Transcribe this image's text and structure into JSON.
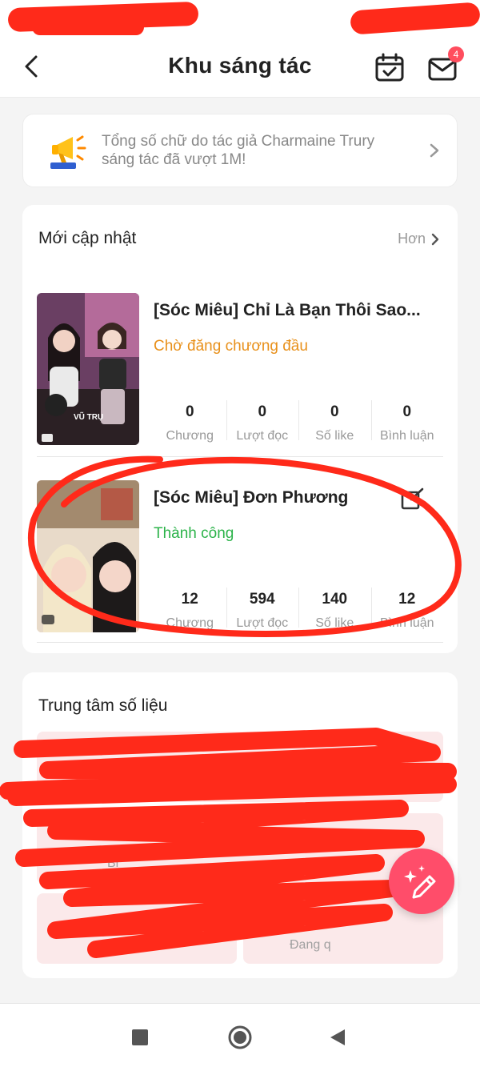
{
  "header": {
    "title": "Khu sáng tác",
    "mail_badge": "4"
  },
  "notice": {
    "text": "Tổng số chữ do tác giả Charmaine Trury sáng tác đã vượt 1M!"
  },
  "recent": {
    "heading": "Mới cập nhật",
    "more_label": "Hơn",
    "books": [
      {
        "title": "[Sóc Miêu] Chỉ Là Bạn Thôi Sao...",
        "status": "Chờ đăng chương đầu",
        "status_color": "#e8901a",
        "cover_caption": "VŨ TRỤ",
        "stats": [
          {
            "value": "0",
            "label": "Chương"
          },
          {
            "value": "0",
            "label": "Lượt đọc"
          },
          {
            "value": "0",
            "label": "Số like"
          },
          {
            "value": "0",
            "label": "Bình luận"
          }
        ]
      },
      {
        "title": "[Sóc Miêu] Đơn Phương",
        "status": "Thành công",
        "status_color": "#2cb34a",
        "cover_caption": "",
        "stats": [
          {
            "value": "12",
            "label": "Chương"
          },
          {
            "value": "594",
            "label": "Lượt đọc"
          },
          {
            "value": "140",
            "label": "Số like"
          },
          {
            "value": "12",
            "label": "Bình luận"
          }
        ]
      }
    ]
  },
  "data_center": {
    "heading": "Trung tâm số liệu",
    "tile_fragments": [
      "Bi",
      "ận",
      "Đang q"
    ]
  },
  "colors": {
    "accent": "#ff4d6a",
    "annotation_red": "#ff2a1a"
  }
}
